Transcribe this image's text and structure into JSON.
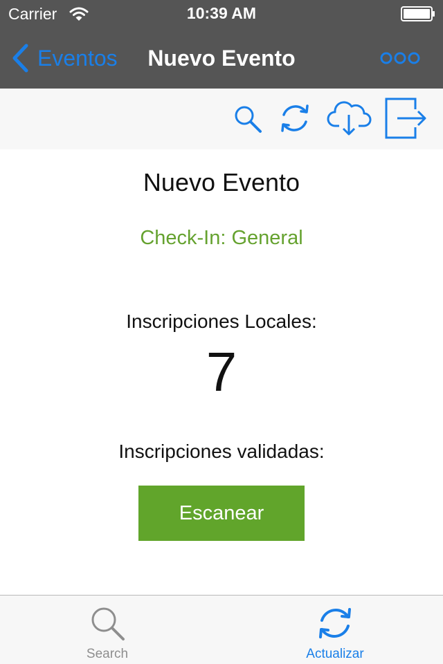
{
  "status_bar": {
    "carrier": "Carrier",
    "time": "10:39 AM",
    "icons": [
      "wifi-icon",
      "battery-icon"
    ]
  },
  "nav_bar": {
    "back_label": "Eventos",
    "title": "Nuevo Evento",
    "more_icon": "more-options-icon"
  },
  "toolbar": {
    "icons": [
      "search-icon",
      "sync-icon",
      "cloud-download-icon",
      "exit-icon"
    ]
  },
  "main": {
    "event_title": "Nuevo Evento",
    "checkin": "Check-In: General",
    "local_label": "Inscripciones Locales:",
    "local_count": "7",
    "validated_label": "Inscripciones validadas:",
    "scan_button": "Escanear"
  },
  "tab_bar": {
    "tabs": [
      {
        "label": "Search",
        "icon": "search-icon",
        "active": false
      },
      {
        "label": "Actualizar",
        "icon": "sync-icon",
        "active": true
      }
    ]
  },
  "colors": {
    "bar_dark": "#555555",
    "accent_blue": "#1a7fe8",
    "green_text": "#65a22f",
    "green_button": "#61a52b",
    "toolbar_bg": "#f7f7f7"
  }
}
